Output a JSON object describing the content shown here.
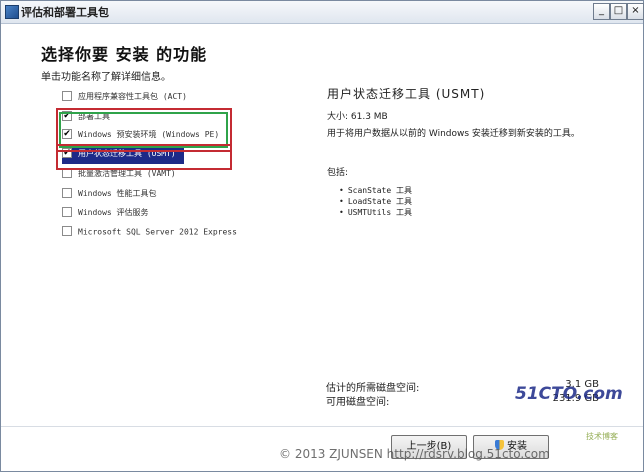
{
  "window": {
    "title": "评估和部署工具包",
    "minimize_label": "_",
    "maximize_label": "□",
    "close_label": "×"
  },
  "main": {
    "heading": "选择你要 安装 的功能",
    "subheading": "单击功能名称了解详细信息。"
  },
  "features": [
    {
      "label": "应用程序兼容性工具包 (ACT)",
      "checked": false,
      "check": ""
    },
    {
      "label": "部署工具",
      "checked": true,
      "check": "✔"
    },
    {
      "label": "Windows 预安装环境 (Windows PE)",
      "checked": true,
      "check": "✔"
    },
    {
      "label": "用户状态迁移工具 (USMT)",
      "checked": true,
      "check": "✔"
    },
    {
      "label": "批量激活管理工具 (VAMT)",
      "checked": false,
      "check": ""
    },
    {
      "label": "Windows 性能工具包",
      "checked": false,
      "check": ""
    },
    {
      "label": "Windows 评估服务",
      "checked": false,
      "check": ""
    },
    {
      "label": "Microsoft SQL Server 2012 Express",
      "checked": false,
      "check": ""
    }
  ],
  "detail": {
    "title": "用户状态迁移工具 (USMT)",
    "size": "大小: 61.3 MB",
    "description": "用于将用户数据从以前的  Windows  安装迁移到新安装的工具。",
    "includes_label": "包括:",
    "includes": [
      "ScanState 工具",
      "LoadState 工具",
      "USMTUtils 工具"
    ]
  },
  "disk": {
    "required_label": "估计的所需磁盘空间:",
    "required_value": "3.1 GB",
    "available_label": "可用磁盘空间:",
    "available_value": "231.9 GB"
  },
  "buttons": {
    "back": "上一步(B)",
    "install": "安装"
  },
  "watermark": {
    "copyright": "© 2013 ZJUNSEN http://rdsrv.blog.51cto.com",
    "logo": "51CTO.com",
    "logo_sub": "技术博客"
  },
  "colors": {
    "selection": "#1d2a88",
    "highlight_red": "#c42b32",
    "highlight_green": "#2fa34a"
  }
}
